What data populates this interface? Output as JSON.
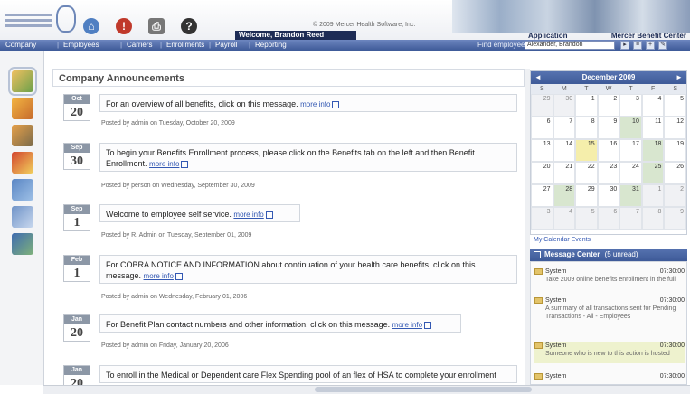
{
  "header": {
    "help_icon_label": "?",
    "welcome": "Welcome, Brandon Reed",
    "copyright": "© 2009 Mercer Health Software, Inc.",
    "right_link_1": "Application",
    "right_link_2": "Mercer Benefit Center"
  },
  "nav": {
    "items": [
      "Company",
      "Employees",
      "Carriers",
      "Enrollments",
      "Payroll",
      "Reporting"
    ],
    "search_label": "Find employee",
    "search_value": "Alexander, Brandon"
  },
  "main": {
    "title": "Company Announcements",
    "announcements": [
      {
        "month": "Oct",
        "day": "20",
        "text": "For an overview of all benefits, click on this message.",
        "link": "more info",
        "posted": "Posted by admin on Tuesday, October 20, 2009"
      },
      {
        "month": "Sep",
        "day": "30",
        "text": "To begin your Benefits Enrollment process, please click on the Benefits tab on the left and then Benefit Enrollment.",
        "link": "more info",
        "posted": "Posted by person on Wednesday, September 30, 2009"
      },
      {
        "month": "Sep",
        "day": "1",
        "text": "Welcome to employee self service.",
        "link": "more info",
        "posted": "Posted by R. Admin on Tuesday, September 01, 2009"
      },
      {
        "month": "Feb",
        "day": "1",
        "text": "For COBRA NOTICE AND INFORMATION about continuation of your health care benefits, click on this message.",
        "link": "more info",
        "posted": "Posted by admin on Wednesday, February 01, 2006"
      },
      {
        "month": "Jan",
        "day": "20",
        "text": "For Benefit Plan contact numbers and other information, click on this message.",
        "link": "more info",
        "posted": "Posted by admin on Friday, January 20, 2006"
      },
      {
        "month": "Jan",
        "day": "20",
        "text": "To enroll in the Medical or Dependent care Flex Spending pool of an flex of HSA to complete your enrollment",
        "link": "",
        "posted": ""
      }
    ]
  },
  "calendar": {
    "month_title": "December 2009",
    "prev": "◄",
    "next": "►",
    "dow": [
      "S",
      "M",
      "T",
      "W",
      "T",
      "F",
      "S"
    ],
    "days": [
      {
        "d": "29",
        "kind": "out"
      },
      {
        "d": "30",
        "kind": "out"
      },
      {
        "d": "1",
        "kind": ""
      },
      {
        "d": "2",
        "kind": ""
      },
      {
        "d": "3",
        "kind": ""
      },
      {
        "d": "4",
        "kind": ""
      },
      {
        "d": "5",
        "kind": ""
      },
      {
        "d": "6",
        "kind": ""
      },
      {
        "d": "7",
        "kind": ""
      },
      {
        "d": "8",
        "kind": ""
      },
      {
        "d": "9",
        "kind": ""
      },
      {
        "d": "10",
        "kind": "ev"
      },
      {
        "d": "11",
        "kind": ""
      },
      {
        "d": "12",
        "kind": ""
      },
      {
        "d": "13",
        "kind": ""
      },
      {
        "d": "14",
        "kind": ""
      },
      {
        "d": "15",
        "kind": "today"
      },
      {
        "d": "16",
        "kind": ""
      },
      {
        "d": "17",
        "kind": ""
      },
      {
        "d": "18",
        "kind": "ev"
      },
      {
        "d": "19",
        "kind": ""
      },
      {
        "d": "20",
        "kind": ""
      },
      {
        "d": "21",
        "kind": ""
      },
      {
        "d": "22",
        "kind": ""
      },
      {
        "d": "23",
        "kind": ""
      },
      {
        "d": "24",
        "kind": ""
      },
      {
        "d": "25",
        "kind": "ev"
      },
      {
        "d": "26",
        "kind": ""
      },
      {
        "d": "27",
        "kind": ""
      },
      {
        "d": "28",
        "kind": "ev"
      },
      {
        "d": "29",
        "kind": ""
      },
      {
        "d": "30",
        "kind": ""
      },
      {
        "d": "31",
        "kind": "ev"
      },
      {
        "d": "1",
        "kind": "out"
      },
      {
        "d": "2",
        "kind": "out"
      },
      {
        "d": "3",
        "kind": "out"
      },
      {
        "d": "4",
        "kind": "out"
      },
      {
        "d": "5",
        "kind": "out"
      },
      {
        "d": "6",
        "kind": "out"
      },
      {
        "d": "7",
        "kind": "out"
      },
      {
        "d": "8",
        "kind": "out"
      },
      {
        "d": "9",
        "kind": "out"
      }
    ],
    "link": "My Calendar Events"
  },
  "message_center": {
    "title": "Message Center",
    "count": "(5 unread)",
    "items": [
      {
        "from": "System",
        "time": "07:30:00",
        "text": "Take 2009 online benefits enrollment in the full"
      },
      {
        "from": "System",
        "time": "07:30:00",
        "text": "A summary of all transactions sent for Pending Transactions - All - Employees"
      },
      {
        "from": "System",
        "time": "07:30:00",
        "text": "Someone who is new to this action is hosted"
      },
      {
        "from": "System",
        "time": "07:30:00",
        "text": ""
      }
    ]
  },
  "colors": {
    "nav": "#3e5a98",
    "accent": "#3358b3",
    "event_day": "#d8e6cf",
    "today": "#f5eeab"
  }
}
